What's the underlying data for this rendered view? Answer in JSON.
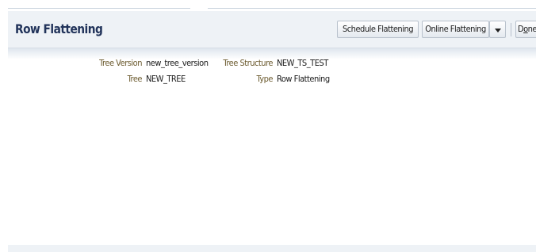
{
  "page": {
    "title": "Row Flattening"
  },
  "toolbar": {
    "schedule_label": "Schedule Flattening",
    "online_label": "Online Flattening",
    "dropdown_icon": "chevron-down-icon",
    "done_label": "Done",
    "done_mnemonic": "o"
  },
  "details": {
    "tree_version_label": "Tree Version",
    "tree_version_value": "new_tree_version",
    "tree_structure_label": "Tree Structure",
    "tree_structure_value": "NEW_TS_TEST",
    "tree_label": "Tree",
    "tree_value": "NEW_TREE",
    "type_label": "Type",
    "type_value": "Row Flattening"
  }
}
